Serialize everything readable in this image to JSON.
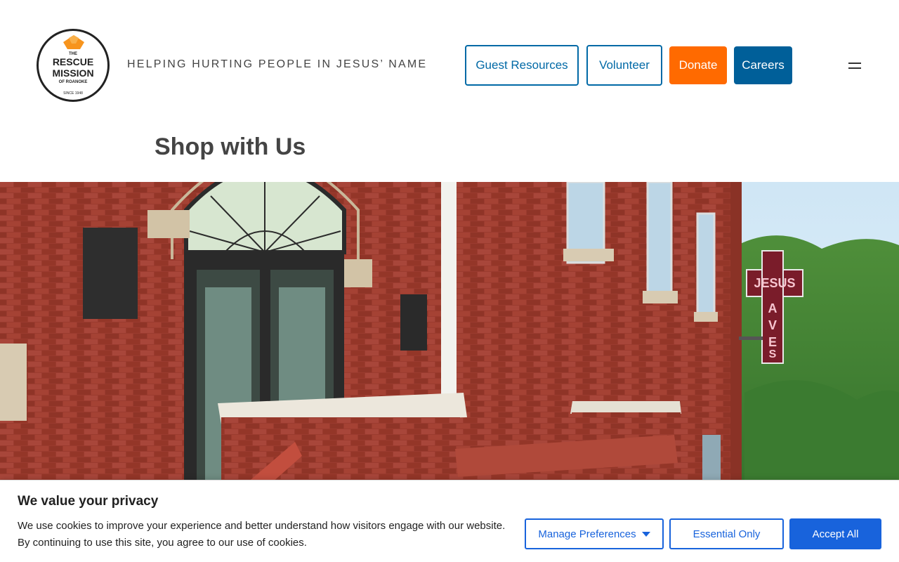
{
  "header": {
    "logo": {
      "line_the": "THE",
      "line_rescue": "RESCUE",
      "line_mission": "MISSION",
      "line_of_roanoke": "OF ROANOKE",
      "line_since": "SINCE 1948"
    },
    "tagline": "HELPING HURTING PEOPLE IN JESUS’ NAME",
    "nav_buttons": {
      "guest_resources": "Guest Resources",
      "volunteer": "Volunteer",
      "donate": "Donate",
      "careers": "Careers"
    },
    "menu_icon": "hamburger-menu-icon"
  },
  "main": {
    "page_title": "Shop with Us",
    "hero": {
      "sign_text_top": "JESUS",
      "sign_text_vertical": "AVES",
      "sign_letter_s": "S"
    }
  },
  "cookie_banner": {
    "title": "We value your privacy",
    "text": "We use cookies to improve your experience and better understand how visitors engage with our website. By continuing to use this site, you agree to our use of cookies.",
    "manage_label": "Manage Preferences",
    "essential_label": "Essential Only",
    "accept_label": "Accept All"
  },
  "colors": {
    "brand_blue": "#0069a6",
    "donate_orange": "#ff6a00",
    "careers_blue": "#005f99",
    "cookie_blue": "#1863dc"
  }
}
